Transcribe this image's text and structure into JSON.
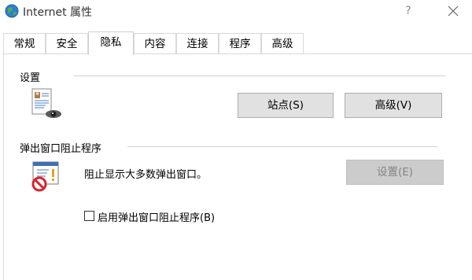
{
  "window": {
    "title": "Internet 属性",
    "help_label": "?"
  },
  "tabs": [
    {
      "label": "常规"
    },
    {
      "label": "安全"
    },
    {
      "label": "隐私",
      "active": true
    },
    {
      "label": "内容"
    },
    {
      "label": "连接"
    },
    {
      "label": "程序"
    },
    {
      "label": "高级"
    }
  ],
  "settings_section": {
    "title": "设置",
    "icon": "privacy-document-eye-icon",
    "sites_button": "站点(S)",
    "advanced_button": "高级(V)"
  },
  "popup_section": {
    "title": "弹出窗口阻止程序",
    "icon": "popup-blocked-icon",
    "description": "阻止显示大多数弹出窗口。",
    "settings_button": "设置(E)",
    "settings_button_disabled": true,
    "checkbox_label": "启用弹出窗口阻止程序(B)",
    "checkbox_checked": false
  },
  "colors": {
    "button_face": "#e1e1e1",
    "button_disabled": "#cccccc",
    "blocked_red": "#d9232e"
  }
}
